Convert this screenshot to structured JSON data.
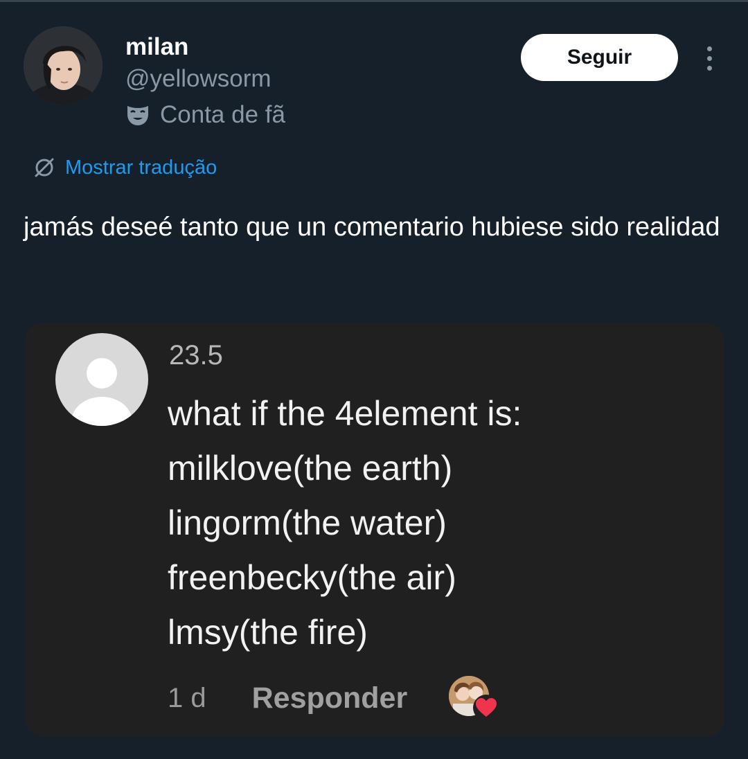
{
  "tweet": {
    "author_name": "milan",
    "author_handle": "@yellowsorm",
    "account_label": "Conta de fã",
    "follow_label": "Seguir",
    "translate_label": "Mostrar tradução",
    "text": "jamás deseé tanto que un comentario hubiese sido realidad"
  },
  "media": {
    "comment": {
      "username": "23.5",
      "lines": [
        "what if the 4element is:",
        "milklove(the earth)",
        "lingorm(the water)",
        "freenbecky(the air)",
        "lmsy(the fire)"
      ],
      "time": "1 d",
      "reply_label": "Responder"
    }
  },
  "icons": {
    "avatar": "profile-photo",
    "fan_account": "theater-mask-icon",
    "more": "more-vertical-icon",
    "translate": "globe-translate-icon",
    "comment_avatar": "default-user-icon",
    "reaction": "heart-reaction-icon"
  },
  "colors": {
    "background": "#15202b",
    "link": "#1d9bf0",
    "secondary_text": "#8b98a5",
    "media_background": "#202020",
    "heart": "#f0344d"
  }
}
